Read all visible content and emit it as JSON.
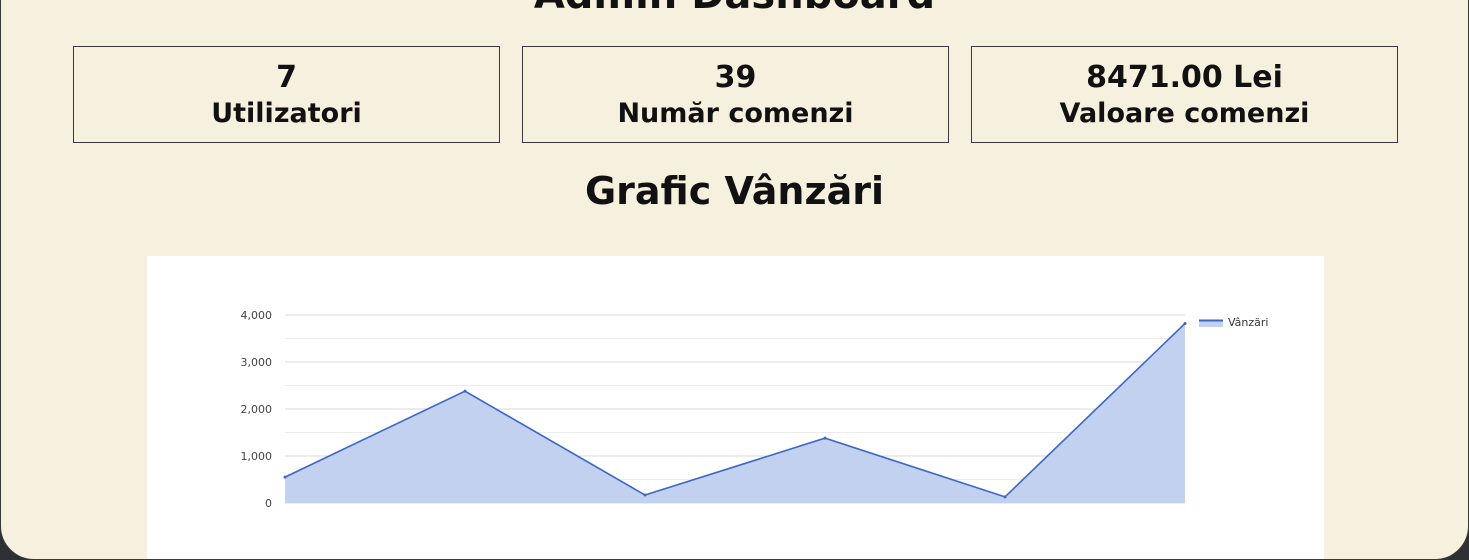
{
  "header": {
    "title": "Admin Dashboard"
  },
  "stats": [
    {
      "value": "7",
      "label": "Utilizatori"
    },
    {
      "value": "39",
      "label": "Număr comenzi"
    },
    {
      "value": "8471.00 Lei",
      "label": "Valoare comenzi"
    }
  ],
  "chart_section": {
    "title": "Grafic Vânzări"
  },
  "colors": {
    "panel_bg": "#f6f0df",
    "outer_bg": "#2e3033",
    "line": "#3c67c6",
    "area_fill": "#c2d1ef",
    "grid": "#d8d8d8"
  },
  "chart_data": {
    "type": "area",
    "x": [
      0,
      1,
      2,
      3,
      4,
      5
    ],
    "series": [
      {
        "name": "Vânzări",
        "values": [
          550,
          2380,
          170,
          1380,
          130,
          3820
        ]
      }
    ],
    "ylim": [
      0,
      4000
    ],
    "yticks": [
      0,
      1000,
      2000,
      3000,
      4000
    ],
    "ytick_labels": [
      "0",
      "1,000",
      "2,000",
      "3,000",
      "4,000"
    ],
    "grid": true,
    "legend": "top-right"
  }
}
